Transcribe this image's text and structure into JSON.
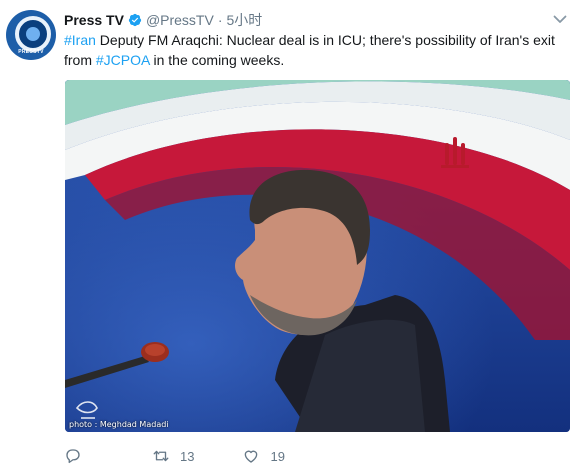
{
  "tweet": {
    "avatar_label": "PRESSTV",
    "display_name": "Press TV",
    "handle": "@PressTV",
    "separator": "·",
    "time": "5小时",
    "text": {
      "hashtag1": "#Iran",
      "part1": " Deputy FM Araqchi: Nuclear deal is in ICU; there's possibility of Iran's exit from ",
      "hashtag2": "#JCPOA",
      "part2": " in the coming weeks."
    },
    "media": {
      "credit": "photo : Meghdad Madadi"
    },
    "actions": {
      "reply_count": "",
      "retweet_count": "13",
      "like_count": "19"
    }
  },
  "colors": {
    "link": "#1da1f2",
    "muted": "#657786",
    "verified": "#1da1f2"
  }
}
